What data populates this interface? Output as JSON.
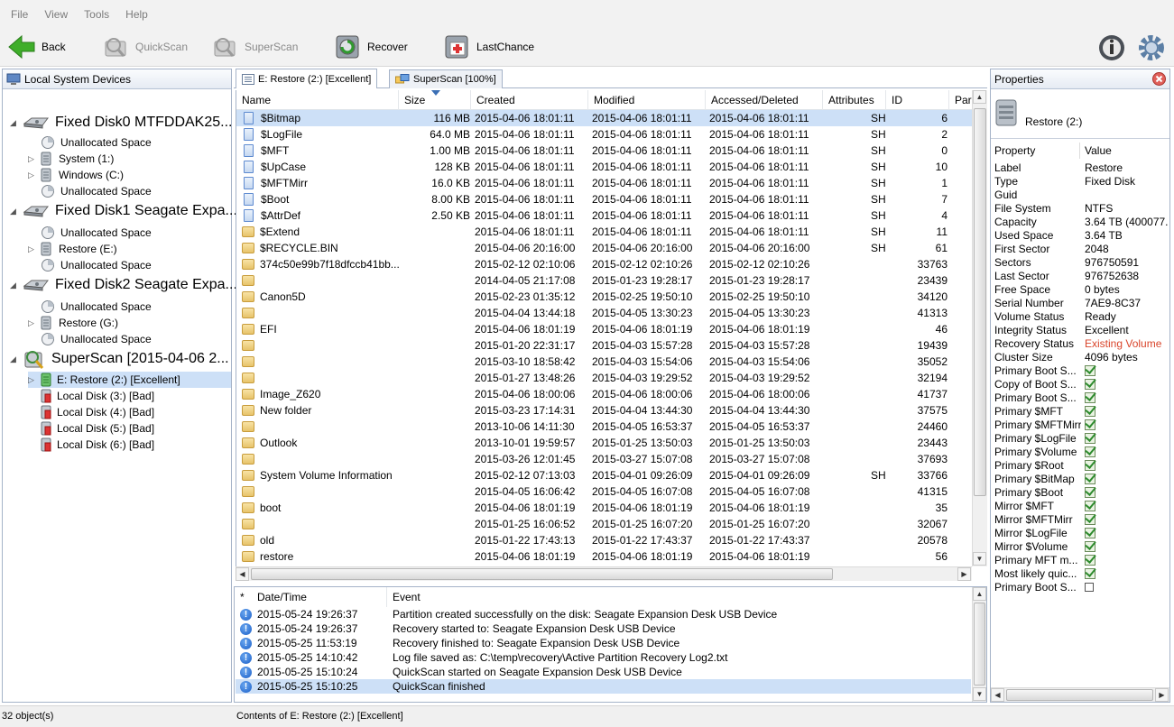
{
  "menu": [
    "File",
    "View",
    "Tools",
    "Help"
  ],
  "toolbar": {
    "back": "Back",
    "quickscan": "QuickScan",
    "superscan": "SuperScan",
    "recover": "Recover",
    "lastchance": "LastChance"
  },
  "left_panel": {
    "title": "Local System Devices",
    "items": [
      {
        "label": "Fixed Disk0 MTFDDAK25...",
        "level": 0,
        "type": "disk"
      },
      {
        "label": "Unallocated Space",
        "level": 1,
        "type": "unalloc"
      },
      {
        "label": "System (1:)",
        "level": 1,
        "type": "volume"
      },
      {
        "label": "Windows (C:)",
        "level": 1,
        "type": "volume"
      },
      {
        "label": "Unallocated Space",
        "level": 1,
        "type": "unalloc"
      },
      {
        "label": "Fixed Disk1 Seagate Expa...",
        "level": 0,
        "type": "disk"
      },
      {
        "label": "Unallocated Space",
        "level": 1,
        "type": "unalloc"
      },
      {
        "label": "Restore (E:)",
        "level": 1,
        "type": "volume"
      },
      {
        "label": "Unallocated Space",
        "level": 1,
        "type": "unalloc"
      },
      {
        "label": "Fixed Disk2 Seagate Expa...",
        "level": 0,
        "type": "disk"
      },
      {
        "label": "Unallocated Space",
        "level": 1,
        "type": "unalloc"
      },
      {
        "label": "Restore (G:)",
        "level": 1,
        "type": "volume"
      },
      {
        "label": "Unallocated Space",
        "level": 1,
        "type": "unalloc"
      },
      {
        "label": "SuperScan [2015-04-06 2...",
        "level": 0,
        "type": "superscan"
      },
      {
        "label": "E: Restore (2:) [Excellent]",
        "level": 1,
        "type": "good"
      },
      {
        "label": "Local Disk (3:) [Bad]",
        "level": 1,
        "type": "bad"
      },
      {
        "label": "Local Disk (4:) [Bad]",
        "level": 1,
        "type": "bad"
      },
      {
        "label": "Local Disk (5:) [Bad]",
        "level": 1,
        "type": "bad"
      },
      {
        "label": "Local Disk (6:) [Bad]",
        "level": 1,
        "type": "bad"
      }
    ]
  },
  "tabs": [
    {
      "label": "E: Restore (2:) [Excellent]"
    },
    {
      "label": "SuperScan [100%]"
    }
  ],
  "file_table": {
    "columns": [
      "Name",
      "Size",
      "Created",
      "Modified",
      "Accessed/Deleted",
      "Attributes",
      "ID",
      "Pare"
    ],
    "rows": [
      {
        "name": "$Bitmap",
        "size": "116 MB",
        "created": "2015-04-06 18:01:11",
        "modified": "2015-04-06 18:01:11",
        "accessed": "2015-04-06 18:01:11",
        "attr": "SH",
        "id": "6",
        "kind": "file"
      },
      {
        "name": "$LogFile",
        "size": "64.0 MB",
        "created": "2015-04-06 18:01:11",
        "modified": "2015-04-06 18:01:11",
        "accessed": "2015-04-06 18:01:11",
        "attr": "SH",
        "id": "2",
        "kind": "file"
      },
      {
        "name": "$MFT",
        "size": "1.00 MB",
        "created": "2015-04-06 18:01:11",
        "modified": "2015-04-06 18:01:11",
        "accessed": "2015-04-06 18:01:11",
        "attr": "SH",
        "id": "0",
        "kind": "file"
      },
      {
        "name": "$UpCase",
        "size": "128 KB",
        "created": "2015-04-06 18:01:11",
        "modified": "2015-04-06 18:01:11",
        "accessed": "2015-04-06 18:01:11",
        "attr": "SH",
        "id": "10",
        "kind": "file"
      },
      {
        "name": "$MFTMirr",
        "size": "16.0 KB",
        "created": "2015-04-06 18:01:11",
        "modified": "2015-04-06 18:01:11",
        "accessed": "2015-04-06 18:01:11",
        "attr": "SH",
        "id": "1",
        "kind": "file"
      },
      {
        "name": "$Boot",
        "size": "8.00 KB",
        "created": "2015-04-06 18:01:11",
        "modified": "2015-04-06 18:01:11",
        "accessed": "2015-04-06 18:01:11",
        "attr": "SH",
        "id": "7",
        "kind": "file"
      },
      {
        "name": "$AttrDef",
        "size": "2.50 KB",
        "created": "2015-04-06 18:01:11",
        "modified": "2015-04-06 18:01:11",
        "accessed": "2015-04-06 18:01:11",
        "attr": "SH",
        "id": "4",
        "kind": "file"
      },
      {
        "name": "$Extend",
        "size": "",
        "created": "2015-04-06 18:01:11",
        "modified": "2015-04-06 18:01:11",
        "accessed": "2015-04-06 18:01:11",
        "attr": "SH",
        "id": "11",
        "kind": "folder"
      },
      {
        "name": "$RECYCLE.BIN",
        "size": "",
        "created": "2015-04-06 20:16:00",
        "modified": "2015-04-06 20:16:00",
        "accessed": "2015-04-06 20:16:00",
        "attr": "SH",
        "id": "61",
        "kind": "folder"
      },
      {
        "name": "374c50e99b7f18dfccb41bb...",
        "size": "",
        "created": "2015-02-12 02:10:06",
        "modified": "2015-02-12 02:10:26",
        "accessed": "2015-02-12 02:10:26",
        "attr": "",
        "id": "33763",
        "kind": "folder"
      },
      {
        "name": "",
        "size": "",
        "created": "2014-04-05 21:17:08",
        "modified": "2015-01-23 19:28:17",
        "accessed": "2015-01-23 19:28:17",
        "attr": "",
        "id": "23439",
        "kind": "folder"
      },
      {
        "name": "Canon5D",
        "size": "",
        "created": "2015-02-23 01:35:12",
        "modified": "2015-02-25 19:50:10",
        "accessed": "2015-02-25 19:50:10",
        "attr": "",
        "id": "34120",
        "kind": "folder"
      },
      {
        "name": "",
        "size": "",
        "created": "2015-04-04 13:44:18",
        "modified": "2015-04-05 13:30:23",
        "accessed": "2015-04-05 13:30:23",
        "attr": "",
        "id": "41313",
        "kind": "folder"
      },
      {
        "name": "EFI",
        "size": "",
        "created": "2015-04-06 18:01:19",
        "modified": "2015-04-06 18:01:19",
        "accessed": "2015-04-06 18:01:19",
        "attr": "",
        "id": "46",
        "kind": "folder"
      },
      {
        "name": "",
        "size": "",
        "created": "2015-01-20 22:31:17",
        "modified": "2015-04-03 15:57:28",
        "accessed": "2015-04-03 15:57:28",
        "attr": "",
        "id": "19439",
        "kind": "folder"
      },
      {
        "name": "",
        "size": "",
        "created": "2015-03-10 18:58:42",
        "modified": "2015-04-03 15:54:06",
        "accessed": "2015-04-03 15:54:06",
        "attr": "",
        "id": "35052",
        "kind": "folder"
      },
      {
        "name": "",
        "size": "",
        "created": "2015-01-27 13:48:26",
        "modified": "2015-04-03 19:29:52",
        "accessed": "2015-04-03 19:29:52",
        "attr": "",
        "id": "32194",
        "kind": "folder"
      },
      {
        "name": "Image_Z620",
        "size": "",
        "created": "2015-04-06 18:00:06",
        "modified": "2015-04-06 18:00:06",
        "accessed": "2015-04-06 18:00:06",
        "attr": "",
        "id": "41737",
        "kind": "folder"
      },
      {
        "name": "New folder",
        "size": "",
        "created": "2015-03-23 17:14:31",
        "modified": "2015-04-04 13:44:30",
        "accessed": "2015-04-04 13:44:30",
        "attr": "",
        "id": "37575",
        "kind": "folder"
      },
      {
        "name": "",
        "size": "",
        "created": "2013-10-06 14:11:30",
        "modified": "2015-04-05 16:53:37",
        "accessed": "2015-04-05 16:53:37",
        "attr": "",
        "id": "24460",
        "kind": "folder"
      },
      {
        "name": "Outlook",
        "size": "",
        "created": "2013-10-01 19:59:57",
        "modified": "2015-01-25 13:50:03",
        "accessed": "2015-01-25 13:50:03",
        "attr": "",
        "id": "23443",
        "kind": "folder"
      },
      {
        "name": "",
        "size": "",
        "created": "2015-03-26 12:01:45",
        "modified": "2015-03-27 15:07:08",
        "accessed": "2015-03-27 15:07:08",
        "attr": "",
        "id": "37693",
        "kind": "folder"
      },
      {
        "name": "System Volume Information",
        "size": "",
        "created": "2015-02-12 07:13:03",
        "modified": "2015-04-01 09:26:09",
        "accessed": "2015-04-01 09:26:09",
        "attr": "SH",
        "id": "33766",
        "kind": "folder"
      },
      {
        "name": "",
        "size": "",
        "created": "2015-04-05 16:06:42",
        "modified": "2015-04-05 16:07:08",
        "accessed": "2015-04-05 16:07:08",
        "attr": "",
        "id": "41315",
        "kind": "folder"
      },
      {
        "name": "boot",
        "size": "",
        "created": "2015-04-06 18:01:19",
        "modified": "2015-04-06 18:01:19",
        "accessed": "2015-04-06 18:01:19",
        "attr": "",
        "id": "35",
        "kind": "folder"
      },
      {
        "name": "",
        "size": "",
        "created": "2015-01-25 16:06:52",
        "modified": "2015-01-25 16:07:20",
        "accessed": "2015-01-25 16:07:20",
        "attr": "",
        "id": "32067",
        "kind": "folder"
      },
      {
        "name": "old",
        "size": "",
        "created": "2015-01-22 17:43:13",
        "modified": "2015-01-22 17:43:37",
        "accessed": "2015-01-22 17:43:37",
        "attr": "",
        "id": "20578",
        "kind": "folder"
      },
      {
        "name": "restore",
        "size": "",
        "created": "2015-04-06 18:01:19",
        "modified": "2015-04-06 18:01:19",
        "accessed": "2015-04-06 18:01:19",
        "attr": "",
        "id": "56",
        "kind": "folder"
      }
    ]
  },
  "log": {
    "columns": [
      "*",
      "Date/Time",
      "Event"
    ],
    "rows": [
      {
        "time": "2015-05-24 19:26:37",
        "event": "Partition created successfully on the disk: Seagate Expansion Desk USB Device"
      },
      {
        "time": "2015-05-24 19:26:37",
        "event": "Recovery started to: Seagate Expansion Desk USB Device"
      },
      {
        "time": "2015-05-25 11:53:19",
        "event": "Recovery finished to: Seagate Expansion Desk USB Device"
      },
      {
        "time": "2015-05-25 14:10:42",
        "event": "Log file saved as: C:\\temp\\recovery\\Active Partition Recovery Log2.txt"
      },
      {
        "time": "2015-05-25 15:10:24",
        "event": "QuickScan started on Seagate Expansion Desk USB Device"
      },
      {
        "time": "2015-05-25 15:10:25",
        "event": "QuickScan finished"
      }
    ]
  },
  "properties": {
    "title": "Properties",
    "volume_name": "Restore (2:)",
    "col_property": "Property",
    "col_value": "Value",
    "rows": [
      {
        "k": "Label",
        "v": "Restore"
      },
      {
        "k": "Type",
        "v": "Fixed Disk"
      },
      {
        "k": "Guid",
        "v": ""
      },
      {
        "k": "File System",
        "v": "NTFS"
      },
      {
        "k": "Capacity",
        "v": "3.64 TB (400077..."
      },
      {
        "k": "Used Space",
        "v": "3.64 TB"
      },
      {
        "k": "First Sector",
        "v": "2048"
      },
      {
        "k": "Sectors",
        "v": "976750591"
      },
      {
        "k": "Last Sector",
        "v": "976752638"
      },
      {
        "k": "Free Space",
        "v": "0 bytes"
      },
      {
        "k": "Serial Number",
        "v": "7AE9-8C37"
      },
      {
        "k": "Volume Status",
        "v": "Ready"
      },
      {
        "k": "Integrity Status",
        "v": "Excellent"
      },
      {
        "k": "Recovery Status",
        "v": "Existing Volume",
        "highlight": true
      },
      {
        "k": "Cluster Size",
        "v": "4096 bytes"
      },
      {
        "k": "Primary Boot S...",
        "check": true
      },
      {
        "k": "Copy of Boot S...",
        "check": true
      },
      {
        "k": "Primary Boot S...",
        "check": true
      },
      {
        "k": "Primary $MFT",
        "check": true
      },
      {
        "k": "Primary $MFTMirr",
        "check": true
      },
      {
        "k": "Primary $LogFile",
        "check": true
      },
      {
        "k": "Primary $Volume",
        "check": true
      },
      {
        "k": "Primary $Root",
        "check": true
      },
      {
        "k": "Primary $BitMap",
        "check": true
      },
      {
        "k": "Primary $Boot",
        "check": true
      },
      {
        "k": "Mirror $MFT",
        "check": true
      },
      {
        "k": "Mirror $MFTMirr",
        "check": true
      },
      {
        "k": "Mirror $LogFile",
        "check": true
      },
      {
        "k": "Mirror $Volume",
        "check": true
      },
      {
        "k": "Primary MFT m...",
        "check": true
      },
      {
        "k": "Most likely quic...",
        "check": true
      },
      {
        "k": "Primary Boot S...",
        "check": false
      }
    ]
  },
  "status": {
    "objects": "32 object(s)",
    "contents": "Contents of E: Restore (2:) [Excellent]"
  },
  "colors": {
    "selection": "#cde0f7",
    "highlight_text": "#d9452b",
    "panel_border": "#a5b3c8"
  }
}
